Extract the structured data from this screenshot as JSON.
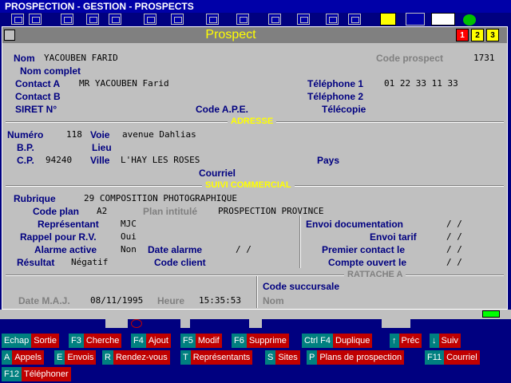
{
  "app": {
    "title": "PROSPECTION - GESTION - PROSPECTS"
  },
  "dialog": {
    "title": "Prospect",
    "buttons": [
      "1",
      "2",
      "3"
    ]
  },
  "identity": {
    "nom_label": "Nom",
    "nom_value": "YACOUBEN FARID",
    "code_prospect_label": "Code prospect",
    "code_prospect_value": "1731",
    "nom_complet_label": "Nom complet",
    "contact_a_label": "Contact A",
    "contact_a_value": "MR YACOUBEN Farid",
    "telephone1_label": "Téléphone 1",
    "telephone1_value": "01 22 33 11 33",
    "contact_b_label": "Contact B",
    "telephone2_label": "Téléphone 2",
    "siret_label": "SIRET N°",
    "code_ape_label": "Code A.P.E.",
    "telecopie_label": "Télécopie"
  },
  "adresse": {
    "section": "ADRESSE",
    "numero_label": "Numéro",
    "numero_value": "118",
    "voie_label": "Voie",
    "voie_value": "avenue Dahlias",
    "bp_label": "B.P.",
    "lieu_label": "Lieu",
    "cp_label": "C.P.",
    "cp_value": "94240",
    "ville_label": "Ville",
    "ville_value": "L'HAY LES ROSES",
    "pays_label": "Pays",
    "courriel_label": "Courriel"
  },
  "commercial": {
    "section": "SUIVI COMMERCIAL",
    "rubrique_label": "Rubrique",
    "rubrique_value": "29 COMPOSITION PHOTOGRAPHIQUE",
    "code_plan_label": "Code plan",
    "code_plan_value": "A2",
    "plan_intitule_label": "Plan intitulé",
    "plan_intitule_value": "PROSPECTION PROVINCE",
    "representant_label": "Représentant",
    "representant_value": "MJC",
    "rappel_label": "Rappel pour R.V.",
    "rappel_value": "Oui",
    "alarme_label": "Alarme active",
    "alarme_value": "Non",
    "date_alarme_label": "Date alarme",
    "date_alarme_value": "/ /",
    "resultat_label": "Résultat",
    "resultat_value": "Négatif",
    "code_client_label": "Code client",
    "envoi_doc_label": "Envoi documentation",
    "envoi_doc_value": "/ /",
    "envoi_tarif_label": "Envoi tarif",
    "envoi_tarif_value": "/ /",
    "premier_contact_label": "Premier contact le",
    "premier_contact_value": "/ /",
    "compte_ouvert_label": "Compte ouvert le",
    "compte_ouvert_value": "/ /"
  },
  "rattache": {
    "section": "RATTACHE A",
    "code_succursale_label": "Code succursale",
    "nom_label": "Nom"
  },
  "maj": {
    "date_label": "Date M.A.J.",
    "date_value": "08/11/1995",
    "heure_label": "Heure",
    "heure_value": "15:35:53"
  },
  "hotkeys": [
    {
      "key": "Echap",
      "label": "Sortie"
    },
    {
      "key": "F3",
      "label": "Cherche"
    },
    {
      "key": "F4",
      "label": "Ajout"
    },
    {
      "key": "F5",
      "label": "Modif"
    },
    {
      "key": "F6",
      "label": "Supprime"
    },
    {
      "key": "Ctrl F4",
      "label": "Duplique"
    },
    {
      "key": "↑",
      "label": "Préc"
    },
    {
      "key": "↓",
      "label": "Suiv"
    },
    {
      "key": "A",
      "label": "Appels"
    },
    {
      "key": "E",
      "label": "Envois"
    },
    {
      "key": "R",
      "label": "Rendez-vous"
    },
    {
      "key": "T",
      "label": "Représentants"
    },
    {
      "key": "S",
      "label": "Sites"
    },
    {
      "key": "P",
      "label": "Plans de prospection"
    },
    {
      "key": "F11",
      "label": "Courriel"
    },
    {
      "key": "F12",
      "label": "Téléphoner"
    }
  ],
  "colors": {
    "background": "#000080",
    "panel": "#c0c0c0",
    "label": "#000080",
    "section": "#ffff00",
    "hotkey_bg": "#c00000",
    "key_bg": "#008080"
  }
}
